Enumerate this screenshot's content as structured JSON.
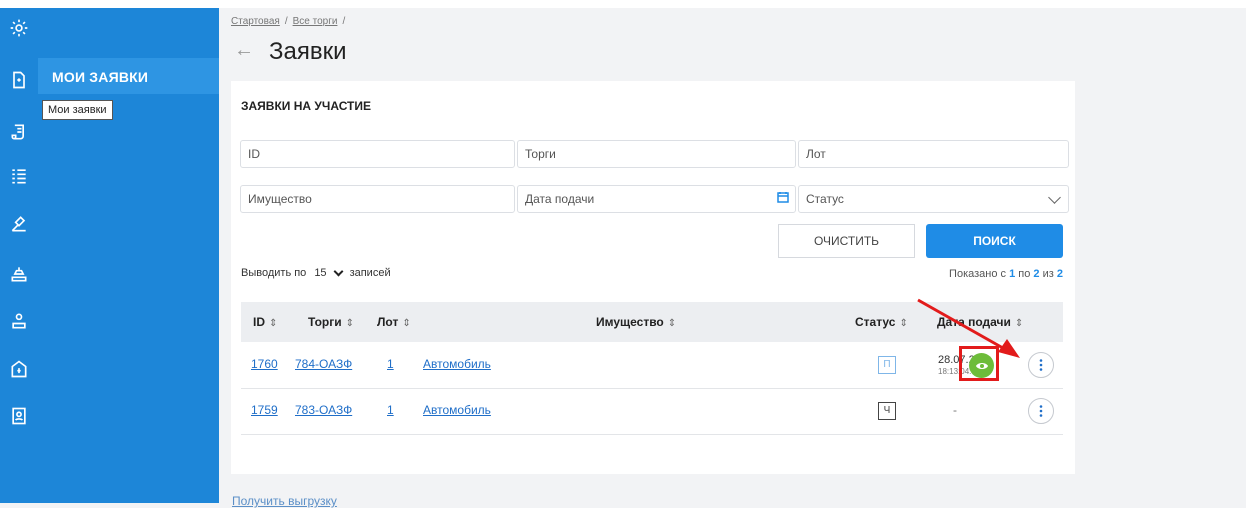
{
  "breadcrumbs": [
    {
      "label": "Стартовая"
    },
    {
      "label": "Все торги"
    }
  ],
  "page_title": "Заявки",
  "sidebar": {
    "active_label": "МОИ ЗАЯВКИ",
    "tooltip": "Мои заявки",
    "icons": [
      "gear-icon",
      "document-icon",
      "scroll-icon",
      "checklist-icon",
      "gavel-icon",
      "auction-icon",
      "badge-icon",
      "money-bag-icon",
      "contacts-icon"
    ]
  },
  "card": {
    "title": "ЗАЯВКИ НА УЧАСТИЕ",
    "filters": {
      "id": "ID",
      "torgi": "Торги",
      "lot": "Лот",
      "imushchestvo": "Имущество",
      "date": "Дата подачи",
      "status": "Статус"
    },
    "clear_label": "ОЧИСТИТЬ",
    "search_label": "ПОИСК",
    "per_page_prefix": "Выводить по",
    "per_page_value": "15",
    "per_page_suffix": "записей",
    "shown_prefix": "Показано с",
    "shown_from": "1",
    "shown_mid": "по",
    "shown_to": "2",
    "shown_of": "из",
    "shown_total": "2"
  },
  "table": {
    "headers": {
      "id": "ID",
      "torgi": "Торги",
      "lot": "Лот",
      "imushchestvo": "Имущество",
      "status": "Статус",
      "date": "Дата подачи"
    },
    "sort_glyph": "⇕",
    "rows": [
      {
        "id": "1760",
        "torgi": "784-ОАЗФ",
        "lot": "1",
        "imushchestvo": "Автомобиль",
        "status": "П",
        "date": "28.07.202",
        "time": "18:13:04:80",
        "status_color": "#7fb6e8"
      },
      {
        "id": "1759",
        "torgi": "783-ОАЗФ",
        "lot": "1",
        "imushchestvo": "Автомобиль",
        "status": "Ч",
        "date": "-",
        "status_color": "#444444"
      }
    ]
  },
  "export_label": "Получить выгрузку",
  "colors": {
    "primary": "#1d86d8",
    "view_button": "#6dbc3a",
    "highlight": "#e21b1b"
  }
}
